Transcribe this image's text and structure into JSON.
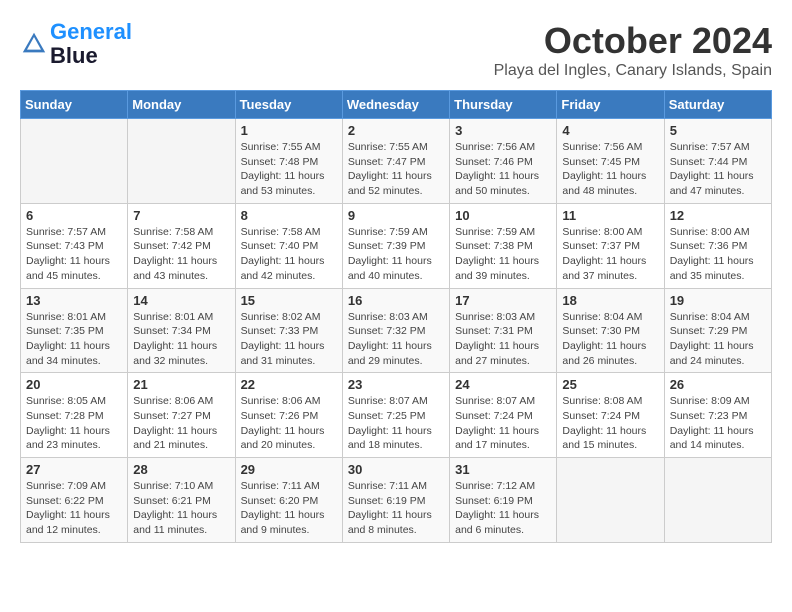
{
  "header": {
    "logo_line1": "General",
    "logo_line2": "Blue",
    "month": "October 2024",
    "location": "Playa del Ingles, Canary Islands, Spain"
  },
  "weekdays": [
    "Sunday",
    "Monday",
    "Tuesday",
    "Wednesday",
    "Thursday",
    "Friday",
    "Saturday"
  ],
  "weeks": [
    [
      {
        "day": "",
        "sunrise": "",
        "sunset": "",
        "daylight": ""
      },
      {
        "day": "",
        "sunrise": "",
        "sunset": "",
        "daylight": ""
      },
      {
        "day": "1",
        "sunrise": "Sunrise: 7:55 AM",
        "sunset": "Sunset: 7:48 PM",
        "daylight": "Daylight: 11 hours and 53 minutes."
      },
      {
        "day": "2",
        "sunrise": "Sunrise: 7:55 AM",
        "sunset": "Sunset: 7:47 PM",
        "daylight": "Daylight: 11 hours and 52 minutes."
      },
      {
        "day": "3",
        "sunrise": "Sunrise: 7:56 AM",
        "sunset": "Sunset: 7:46 PM",
        "daylight": "Daylight: 11 hours and 50 minutes."
      },
      {
        "day": "4",
        "sunrise": "Sunrise: 7:56 AM",
        "sunset": "Sunset: 7:45 PM",
        "daylight": "Daylight: 11 hours and 48 minutes."
      },
      {
        "day": "5",
        "sunrise": "Sunrise: 7:57 AM",
        "sunset": "Sunset: 7:44 PM",
        "daylight": "Daylight: 11 hours and 47 minutes."
      }
    ],
    [
      {
        "day": "6",
        "sunrise": "Sunrise: 7:57 AM",
        "sunset": "Sunset: 7:43 PM",
        "daylight": "Daylight: 11 hours and 45 minutes."
      },
      {
        "day": "7",
        "sunrise": "Sunrise: 7:58 AM",
        "sunset": "Sunset: 7:42 PM",
        "daylight": "Daylight: 11 hours and 43 minutes."
      },
      {
        "day": "8",
        "sunrise": "Sunrise: 7:58 AM",
        "sunset": "Sunset: 7:40 PM",
        "daylight": "Daylight: 11 hours and 42 minutes."
      },
      {
        "day": "9",
        "sunrise": "Sunrise: 7:59 AM",
        "sunset": "Sunset: 7:39 PM",
        "daylight": "Daylight: 11 hours and 40 minutes."
      },
      {
        "day": "10",
        "sunrise": "Sunrise: 7:59 AM",
        "sunset": "Sunset: 7:38 PM",
        "daylight": "Daylight: 11 hours and 39 minutes."
      },
      {
        "day": "11",
        "sunrise": "Sunrise: 8:00 AM",
        "sunset": "Sunset: 7:37 PM",
        "daylight": "Daylight: 11 hours and 37 minutes."
      },
      {
        "day": "12",
        "sunrise": "Sunrise: 8:00 AM",
        "sunset": "Sunset: 7:36 PM",
        "daylight": "Daylight: 11 hours and 35 minutes."
      }
    ],
    [
      {
        "day": "13",
        "sunrise": "Sunrise: 8:01 AM",
        "sunset": "Sunset: 7:35 PM",
        "daylight": "Daylight: 11 hours and 34 minutes."
      },
      {
        "day": "14",
        "sunrise": "Sunrise: 8:01 AM",
        "sunset": "Sunset: 7:34 PM",
        "daylight": "Daylight: 11 hours and 32 minutes."
      },
      {
        "day": "15",
        "sunrise": "Sunrise: 8:02 AM",
        "sunset": "Sunset: 7:33 PM",
        "daylight": "Daylight: 11 hours and 31 minutes."
      },
      {
        "day": "16",
        "sunrise": "Sunrise: 8:03 AM",
        "sunset": "Sunset: 7:32 PM",
        "daylight": "Daylight: 11 hours and 29 minutes."
      },
      {
        "day": "17",
        "sunrise": "Sunrise: 8:03 AM",
        "sunset": "Sunset: 7:31 PM",
        "daylight": "Daylight: 11 hours and 27 minutes."
      },
      {
        "day": "18",
        "sunrise": "Sunrise: 8:04 AM",
        "sunset": "Sunset: 7:30 PM",
        "daylight": "Daylight: 11 hours and 26 minutes."
      },
      {
        "day": "19",
        "sunrise": "Sunrise: 8:04 AM",
        "sunset": "Sunset: 7:29 PM",
        "daylight": "Daylight: 11 hours and 24 minutes."
      }
    ],
    [
      {
        "day": "20",
        "sunrise": "Sunrise: 8:05 AM",
        "sunset": "Sunset: 7:28 PM",
        "daylight": "Daylight: 11 hours and 23 minutes."
      },
      {
        "day": "21",
        "sunrise": "Sunrise: 8:06 AM",
        "sunset": "Sunset: 7:27 PM",
        "daylight": "Daylight: 11 hours and 21 minutes."
      },
      {
        "day": "22",
        "sunrise": "Sunrise: 8:06 AM",
        "sunset": "Sunset: 7:26 PM",
        "daylight": "Daylight: 11 hours and 20 minutes."
      },
      {
        "day": "23",
        "sunrise": "Sunrise: 8:07 AM",
        "sunset": "Sunset: 7:25 PM",
        "daylight": "Daylight: 11 hours and 18 minutes."
      },
      {
        "day": "24",
        "sunrise": "Sunrise: 8:07 AM",
        "sunset": "Sunset: 7:24 PM",
        "daylight": "Daylight: 11 hours and 17 minutes."
      },
      {
        "day": "25",
        "sunrise": "Sunrise: 8:08 AM",
        "sunset": "Sunset: 7:24 PM",
        "daylight": "Daylight: 11 hours and 15 minutes."
      },
      {
        "day": "26",
        "sunrise": "Sunrise: 8:09 AM",
        "sunset": "Sunset: 7:23 PM",
        "daylight": "Daylight: 11 hours and 14 minutes."
      }
    ],
    [
      {
        "day": "27",
        "sunrise": "Sunrise: 7:09 AM",
        "sunset": "Sunset: 6:22 PM",
        "daylight": "Daylight: 11 hours and 12 minutes."
      },
      {
        "day": "28",
        "sunrise": "Sunrise: 7:10 AM",
        "sunset": "Sunset: 6:21 PM",
        "daylight": "Daylight: 11 hours and 11 minutes."
      },
      {
        "day": "29",
        "sunrise": "Sunrise: 7:11 AM",
        "sunset": "Sunset: 6:20 PM",
        "daylight": "Daylight: 11 hours and 9 minutes."
      },
      {
        "day": "30",
        "sunrise": "Sunrise: 7:11 AM",
        "sunset": "Sunset: 6:19 PM",
        "daylight": "Daylight: 11 hours and 8 minutes."
      },
      {
        "day": "31",
        "sunrise": "Sunrise: 7:12 AM",
        "sunset": "Sunset: 6:19 PM",
        "daylight": "Daylight: 11 hours and 6 minutes."
      },
      {
        "day": "",
        "sunrise": "",
        "sunset": "",
        "daylight": ""
      },
      {
        "day": "",
        "sunrise": "",
        "sunset": "",
        "daylight": ""
      }
    ]
  ]
}
